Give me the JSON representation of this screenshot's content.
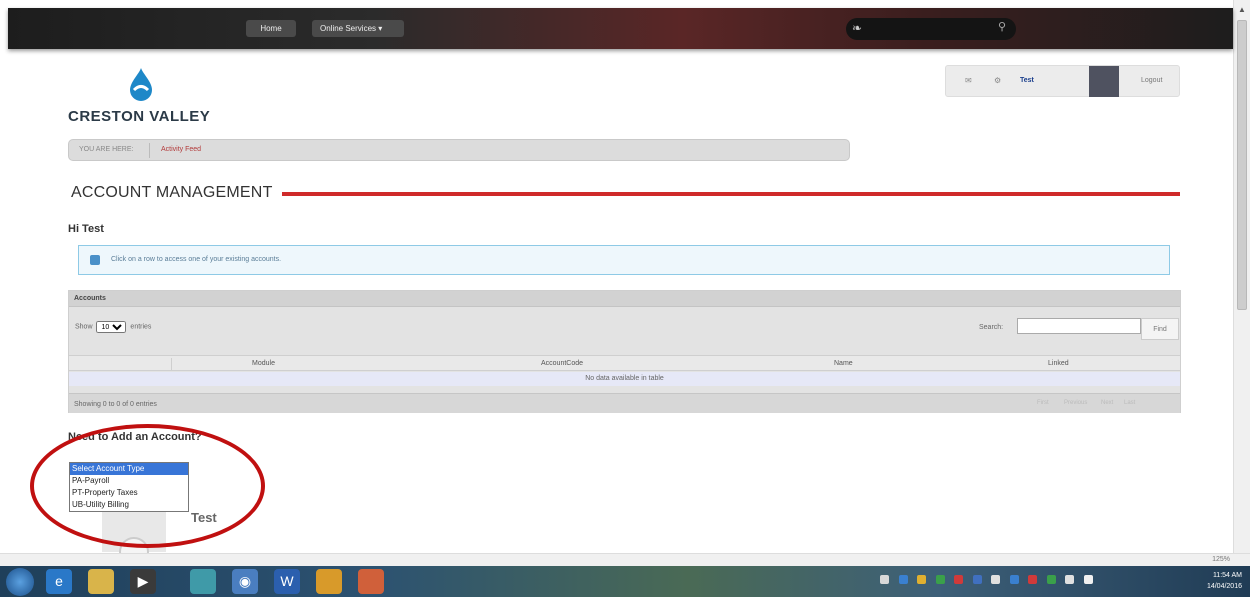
{
  "nav": {
    "home": "Home",
    "online_services": "Online Services ▾"
  },
  "logo": {
    "name": "CRESTON VALLEY"
  },
  "account_bar": {
    "user": "Test",
    "logout": "Logout"
  },
  "breadcrumb": {
    "you_are_here": "YOU ARE HERE:",
    "current": "Activity Feed"
  },
  "page": {
    "title": "ACCOUNT MANAGEMENT",
    "greeting": "Hi Test",
    "info": "Click on a row to access one of your existing accounts."
  },
  "accounts": {
    "header": "Accounts",
    "show_label": "Show",
    "show_value": "10",
    "entries_label": "entries",
    "search_label": "Search:",
    "find_label": "Find",
    "columns": [
      "Module",
      "AccountCode",
      "Name",
      "Linked"
    ],
    "no_data": "No data available in table",
    "showing": "Showing 0 to 0 of 0 entries",
    "pager": [
      "First",
      "Previous",
      "Next",
      "Last"
    ]
  },
  "add_account": {
    "heading": "Need to Add an Account?",
    "options": [
      "Select Account Type",
      "PA-Payroll",
      "PT-Property Taxes",
      "UB-Utility Billing"
    ],
    "user_name": "Test"
  },
  "status": {
    "zoom": "125%"
  },
  "taskbar": {
    "time": "11:54 AM",
    "date": "14/04/2016"
  },
  "colors": {
    "accent_red": "#cf2a2a",
    "link_blue": "#1a3e8c",
    "select_blue": "#3875d7"
  }
}
